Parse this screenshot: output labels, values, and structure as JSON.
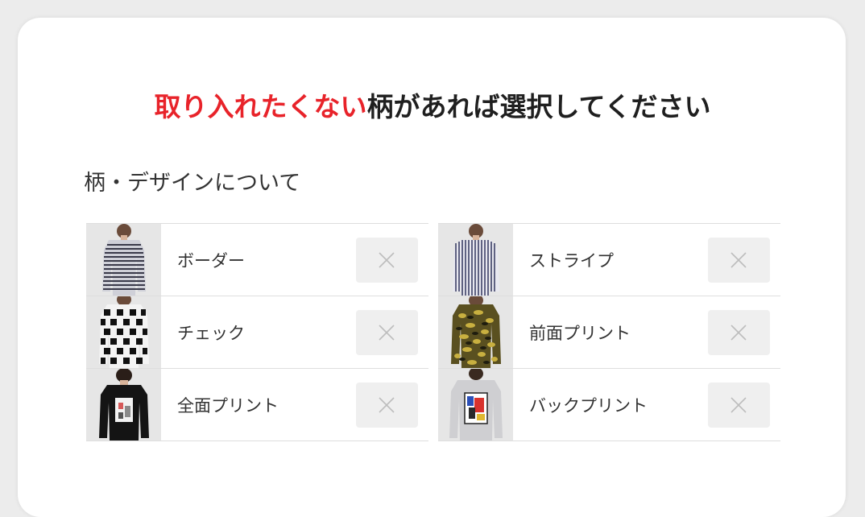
{
  "header": {
    "title_highlight": "取り入れたくない",
    "title_rest": "柄があれば選択してください"
  },
  "section": {
    "title": "柄・デザインについて"
  },
  "patterns": {
    "left": [
      {
        "label": "ボーダー",
        "icon": "long-sleeve-border-shirt"
      },
      {
        "label": "チェック",
        "icon": "long-sleeve-check-shirt"
      },
      {
        "label": "全面プリント",
        "icon": "long-sleeve-front-print-shirt"
      }
    ],
    "right": [
      {
        "label": "ストライプ",
        "icon": "long-sleeve-stripe-shirt"
      },
      {
        "label": "前面プリント",
        "icon": "camo-print-shirt"
      },
      {
        "label": "バックプリント",
        "icon": "back-print-sweatshirt"
      }
    ]
  },
  "colors": {
    "accent": "#e8232a",
    "text": "#333333",
    "button_bg": "#efefef"
  }
}
